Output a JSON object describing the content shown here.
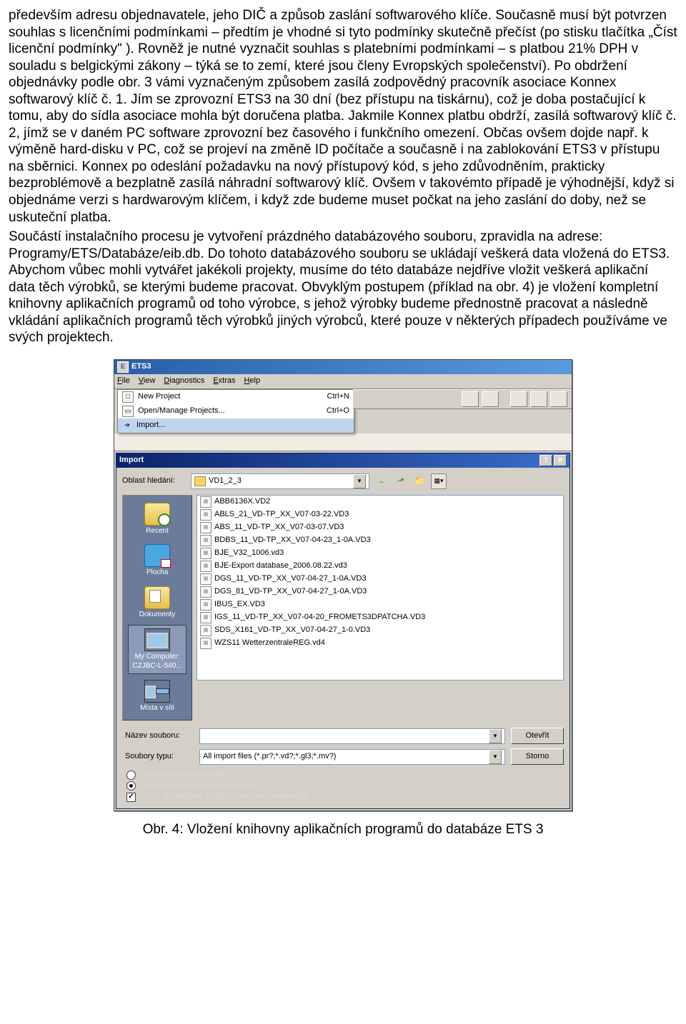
{
  "paragraphs": {
    "p1": "především adresu objednavatele, jeho DIČ a způsob zaslání softwarového klíče. Současně musí být potvrzen souhlas s licenčními podmínkami – předtím je vhodné si tyto podmínky skutečně přečíst (po stisku tlačítka „Číst licenční podmínky\" ). Rovněž je nutné vyznačit souhlas s platebními podmínkami – s platbou 21% DPH v souladu s belgickými zákony – týká se to zemí, které jsou členy Evropských společenství). Po obdržení objednávky podle obr. 3 vámi vyznačeným způsobem zasílá zodpovědný pracovník asociace Konnex softwarový klíč č. 1. Jím se zprovozní ETS3 na 30 dní (bez přístupu na tiskárnu), což je doba postačující k tomu, aby do sídla asociace mohla být doručena platba. Jakmile Konnex platbu obdrží, zasílá softwarový klíč č. 2, jímž se v daném PC software zprovozní bez časového i funkčního omezení. Občas ovšem dojde např. k výměně hard-disku v PC, což se projeví na změně ID počítače a současně i na zablokování ETS3 v přístupu na sběrnici. Konnex po odeslání požadavku na nový přístupový kód, s jeho zdůvodněním, prakticky bezproblémově a bezplatně zasílá náhradní softwarový klíč. Ovšem v takovémto případě je výhodnější, když si objednáme verzi s hardwarovým klíčem, i když zde budeme muset počkat na jeho zaslání do doby, než se uskuteční platba.",
    "p2": "Součástí instalačního procesu je vytvoření prázdného databázového souboru, zpravidla na adrese: Programy/ETS/Databáze/eib.db. Do tohoto databázového souboru se ukládají veškerá data vložená do ETS3. Abychom vůbec mohli vytvářet jakékoli projekty, musíme do této databáze nejdříve vložit veškerá aplikační data těch výrobků, se kterými budeme pracovat. Obvyklým postupem (příklad na obr. 4) je vložení kompletní knihovny aplikačních programů od toho výrobce, s jehož výrobky budeme přednostně pracovat a následně vkládání aplikačních programů těch výrobků jiných výrobců, které pouze v některých případech používáme ve svých projektech."
  },
  "ets": {
    "title": "ETS3",
    "menus": [
      "File",
      "View",
      "Diagnostics",
      "Extras",
      "Help"
    ],
    "dropdown": [
      {
        "icon": "new",
        "label": "New Project",
        "shortcut": "Ctrl+N"
      },
      {
        "icon": "open",
        "label": "Open/Manage Projects...",
        "shortcut": "Ctrl+O"
      },
      {
        "icon": "import",
        "label": "Import...",
        "shortcut": ""
      }
    ]
  },
  "import": {
    "title": "Import",
    "lookin_label": "Oblast hledání:",
    "folder": "VD1_2_3",
    "files": [
      "ABB6136X.VD2",
      "ABLS_21_VD-TP_XX_V07-03-22.VD3",
      "ABS_11_VD-TP_XX_V07-03-07.VD3",
      "BDBS_11_VD-TP_XX_V07-04-23_1-0A.VD3",
      "BJE_V32_1006.vd3",
      "BJE-Export database_2006.08.22.vd3",
      "DGS_11_VD-TP_XX_V07-04-27_1-0A.VD3",
      "DGS_81_VD-TP_XX_V07-04-27_1-0A.VD3",
      "IBUS_EX.VD3",
      "IGS_11_VD-TP_XX_V07-04-20_FROMETS3DPATCHA.VD3",
      "SDS_X161_VD-TP_XX_V07-04-27_1-0.VD3",
      "WZS11 WetterzentraleREG.vd4"
    ],
    "filename_label": "Název souboru:",
    "filename_value": "",
    "filetype_label": "Soubory typu:",
    "filetype_value": "All import files (*.pr?;*.vd?;*.gl3;*.mv?)",
    "open_btn": "Otevřít",
    "cancel_btn": "Storno",
    "radio1": "Import all items in the file",
    "radio2": "Let me select the items to import",
    "check1": "Close all windows during import (recommended)"
  },
  "places": [
    {
      "cls": "pi-recent",
      "label": "Recent"
    },
    {
      "cls": "pi-desktop",
      "label": "Plocha"
    },
    {
      "cls": "pi-docs",
      "label": "Dokumenty"
    },
    {
      "cls": "pi-comp",
      "label": "My Computer:\nCZJBC-L-540..."
    },
    {
      "cls": "pi-net",
      "label": "Místa v síti"
    }
  ],
  "caption": "Obr. 4: Vložení knihovny aplikačních programů do databáze ETS 3"
}
